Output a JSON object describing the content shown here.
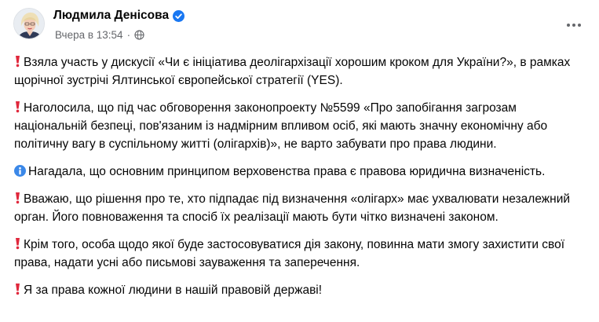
{
  "post": {
    "author": "Людмила Денісова",
    "timestamp": "Вчера в 13:54",
    "separator": "·",
    "privacy_icon": "globe-icon",
    "menu_icon": "more-horizontal-icon",
    "verified_icon": "verified-badge-icon",
    "accent_color": "#1877f2",
    "paragraphs": [
      {
        "icon": "exclamation-icon",
        "text": "Взяла участь у дискусії «Чи є ініціатива деолігархізації хорошим кроком для України?», в рамках щорічної зустрічі Ялтинської європейської стратегії (YES)."
      },
      {
        "icon": "exclamation-icon",
        "text": "Наголосила, що під час обговорення законопроекту №5599 «Про запобігання загрозам національній безпеці, пов'язаним із надмірним впливом осіб, які мають значну економічну або політичну вагу в суспільному житті (олігархів)», не варто забувати про права людини."
      },
      {
        "icon": "information-icon",
        "text": "Нагадала, що основним принципом верховенства права є правова юридична визначеність."
      },
      {
        "icon": "exclamation-icon",
        "text": "Вважаю, що рішення про те, хто підпадає під визначення «олігарх» має ухвалювати незалежний орган. Його повноваження та спосіб їх реалізації мають бути чітко визначені законом."
      },
      {
        "icon": "exclamation-icon",
        "text": "Крім того, особа щодо якої буде застосовуватися дія закону, повинна мати змогу захистити свої права, надати усні або письмові зауваження та заперечення."
      },
      {
        "icon": "exclamation-icon",
        "text": "Я за права кожної людини в нашій правовій державі!"
      }
    ]
  }
}
